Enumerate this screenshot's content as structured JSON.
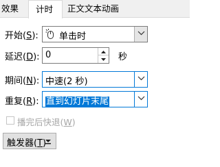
{
  "tabs": [
    {
      "label": "效果"
    },
    {
      "label": "计时"
    },
    {
      "label": "正文文本动画"
    }
  ],
  "start": {
    "label": "开始",
    "key": "S",
    "value": "单击时",
    "icon": "mouse-click-icon"
  },
  "delay": {
    "label": "延迟",
    "key": "D",
    "value": "0",
    "unit": "秒"
  },
  "period": {
    "label": "期间",
    "key": "N",
    "value": "中速(2 秒)"
  },
  "repeat": {
    "label": "重复",
    "key": "R",
    "value": "直到幻灯片末尾"
  },
  "rewind": {
    "label": "播完后快退",
    "key": "W",
    "checked": false,
    "disabled": true
  },
  "trigger": {
    "label": "触发器",
    "key": "T"
  },
  "colors": {
    "accent": "#0078d7",
    "disabled_text": "#a6a6a6"
  }
}
